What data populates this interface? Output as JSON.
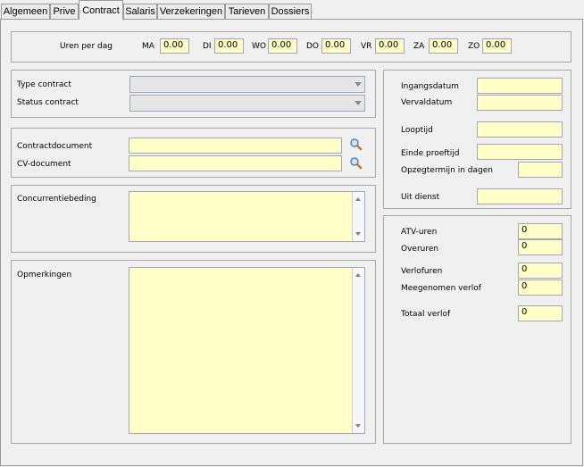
{
  "tabs": [
    {
      "label": "Algemeen"
    },
    {
      "label": "Prive"
    },
    {
      "label": "Contract"
    },
    {
      "label": "Salaris"
    },
    {
      "label": "Verzekeringen"
    },
    {
      "label": "Tarieven"
    },
    {
      "label": "Dossiers"
    }
  ],
  "active_tab": "Contract",
  "hours": {
    "label": "Uren per dag",
    "days": [
      {
        "label": "MA",
        "value": "0.00"
      },
      {
        "label": "DI",
        "value": "0.00"
      },
      {
        "label": "WO",
        "value": "0.00"
      },
      {
        "label": "DO",
        "value": "0.00"
      },
      {
        "label": "VR",
        "value": "0.00"
      },
      {
        "label": "ZA",
        "value": "0.00"
      },
      {
        "label": "ZO",
        "value": "0.00"
      }
    ]
  },
  "contract": {
    "type_label": "Type contract",
    "type_value": "",
    "status_label": "Status contract",
    "status_value": ""
  },
  "documents": {
    "contract_label": "Contractdocument",
    "contract_value": "",
    "cv_label": "CV-document",
    "cv_value": ""
  },
  "concurrentie": {
    "label": "Concurrentiebeding",
    "value": ""
  },
  "opmerkingen": {
    "label": "Opmerkingen",
    "value": ""
  },
  "dates": {
    "ingangsdatum_label": "Ingangsdatum",
    "ingangsdatum_value": "",
    "vervaldatum_label": "Vervaldatum",
    "vervaldatum_value": "",
    "looptijd_label": "Looptijd",
    "looptijd_value": "",
    "proeftijd_label": "Einde proeftijd",
    "proeftijd_value": "",
    "opzeg_label": "Opzegtermijn in dagen",
    "opzeg_value": "",
    "uitdienst_label": "Uit dienst",
    "uitdienst_value": ""
  },
  "leave": {
    "atv_label": "ATV-uren",
    "atv_value": "0",
    "overuren_label": "Overuren",
    "overuren_value": "0",
    "verlof_label": "Verlofuren",
    "verlof_value": "0",
    "meegenomen_label": "Meegenomen verlof",
    "meegenomen_value": "0",
    "totaal_label": "Totaal verlof",
    "totaal_value": "0"
  },
  "icons": {
    "contract_search": "search-icon",
    "cv_search": "search-icon"
  }
}
